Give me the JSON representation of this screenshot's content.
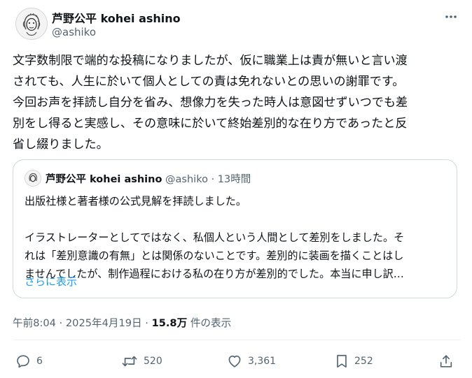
{
  "author": {
    "display_name": "芦野公平 kohei ashino",
    "handle": "@ashiko"
  },
  "post": {
    "text": "文字数制限で端的な投稿になりましたが、仮に職業上は責が無いと言い渡\nされても、人生に於いて個人としての責は免れないとの思いの謝罪です。\n今回お声を拝読し自分を省み、想像力を失った時人は意図せずいつでも差\n別をし得ると実感し、その意味に於いて終始差別的な在り方であったと反\n省し綴りました。"
  },
  "quoted_post": {
    "display_name": "芦野公平 kohei ashino",
    "meta": "@ashiko · 13時間",
    "text": "出版社様と著者様の公式見解を拝読しました。\n\nイラストレーターとしてではなく、私個人という人間として差別をしました。そ\nれは「差別意識の有無」とは関係のないことです。差別的に装画を描くことはし\nませんでしたが、制作過程における私の在り方が差別的でした。本当に申し訳…",
    "show_more": "さらに表示"
  },
  "timestamp": "午前8:04 · 2025年4月19日 · ",
  "views_count": "15.8万",
  "views_label": " 件の表示",
  "actions": {
    "replies": "6",
    "reposts": "520",
    "likes": "3,361",
    "bookmarks": "252"
  },
  "icons": [
    "more-icon",
    "reply-icon",
    "repost-icon",
    "like-icon",
    "bookmark-icon",
    "share-icon"
  ],
  "colors": {
    "text": "#0f1419",
    "secondary": "#536471",
    "link": "#1d9bf0",
    "border": "#cfd9de"
  }
}
